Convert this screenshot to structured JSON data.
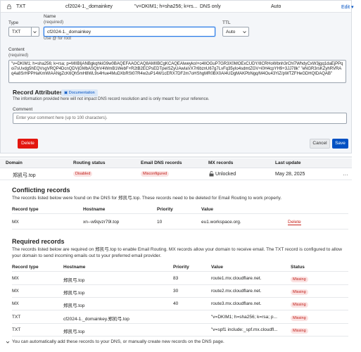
{
  "record_row": {
    "type": "TXT",
    "name": "cf2024-1._domainkey",
    "content": "\"v=DKIM1; h=sha256; k=rs...",
    "proxy": "DNS only",
    "ttl": "Auto",
    "edit_label": "Edit ▾"
  },
  "form": {
    "type_label": "Type",
    "type_value": "TXT",
    "name_label": "Name",
    "name_required": "(required)",
    "name_value": "cf2024-1._domainkey",
    "name_hint": "Use @ for root",
    "ttl_label": "TTL",
    "ttl_value": "Auto",
    "content_label": "Content",
    "content_required": "(required)",
    "content_value": "\"v=DKIM1; h=sha256; k=rsa; p=MIIBIjANBgkqhkiG9w0BAQEFAAOCAQ8AMIIBCgKCAQEAlweykoI+o4lIOGuP7GR3X0MOExCUDY/8CRHoWbnh3rChl7WhdyCxW3jgq1daEjPPqoi7sUvdg5hEQVsgVRQP4DcnQDVjGMbASQtrV4WmB1WebF+R2tB2ECPsEDTpeISZyUAwIaVX7r6bznU67g7LvFq35yIo4sdmtZGV+i0H4cpYH9+3JJ78k\" \"eNGR3rsKZyhRVRAq4a8SrHPPHaKmWIAANgZcK6Qh5mH8WL9s4Hue4MuDXbRSt07R4w2uP14W1cERX7DF2m7oHShgMR0BX0AI4UDgMAKPbNgq/M4Ou43YiZ/pWTZFHeGDHQIDAQAB\""
  },
  "attributes": {
    "title": "Record Attributes",
    "doc_badge": "Documentation",
    "description": "The information provided here will not impact DNS record resolution and is only meant for your reference.",
    "comment_label": "Comment",
    "comment_placeholder": "Enter your comment here (up to 100 characters)."
  },
  "buttons": {
    "delete": "Delete",
    "cancel": "Cancel",
    "save": "Save"
  },
  "table_headers": {
    "domain": "Domain",
    "routing": "Routing status",
    "email_dns": "Email DNS records",
    "mx": "MX records",
    "last_update": "Last update"
  },
  "domain_row": {
    "domain": "郑凯弓.top",
    "routing": "Disabled",
    "email_dns": "Misconfigured",
    "mx": "Unlocked",
    "last_update": "May 28, 2025",
    "menu": "···"
  },
  "conflicting": {
    "title": "Conflicting records",
    "description": "The records listed below were found on the DNS for 郑凯弓.top. These records need to be deleted for Email Routing to work properly.",
    "headers": [
      "Record type",
      "Hostname",
      "Priority",
      "Value"
    ],
    "rows": [
      {
        "type": "MX",
        "hostname": "xn--w9qvzr79l.top",
        "priority": "10",
        "value": "eu1.workspace.org.",
        "action": "Delete"
      }
    ]
  },
  "required": {
    "title": "Required records",
    "description": "The records listed below are required on 郑凯弓.top to enable Email Routing. MX records allow your domain to receive email. The TXT record is configured to allow your domain to send incoming emails out to your preferred email provider.",
    "headers": [
      "Record type",
      "Hostname",
      "Priority",
      "Value",
      "Status"
    ],
    "rows": [
      {
        "type": "MX",
        "hostname": "郑凯弓.top",
        "priority": "83",
        "value": "route1.mx.cloudflare.net.",
        "status": "Missing"
      },
      {
        "type": "MX",
        "hostname": "郑凯弓.top",
        "priority": "30",
        "value": "route2.mx.cloudflare.net.",
        "status": "Missing"
      },
      {
        "type": "MX",
        "hostname": "郑凯弓.top",
        "priority": "40",
        "value": "route3.mx.cloudflare.net.",
        "status": "Missing"
      },
      {
        "type": "TXT",
        "hostname": "cf2024-1._domainkey.郑凯弓.top",
        "priority": "",
        "value": "\"v=DKIM1; h=sha256; k=rsa; p...",
        "status": "Missing"
      },
      {
        "type": "TXT",
        "hostname": "郑凯弓.top",
        "priority": "",
        "value": "\"v=spf1 include:_spf.mx.cloudfl...",
        "status": "Missing"
      }
    ]
  },
  "footer": "You can automatically add these records to your DNS, or manually create new records on the DNS page.",
  "colors": {
    "accent": "#0051c3",
    "danger": "#e3160f",
    "pill_bg": "#fbe2e2",
    "pill_text": "#c0221c"
  }
}
